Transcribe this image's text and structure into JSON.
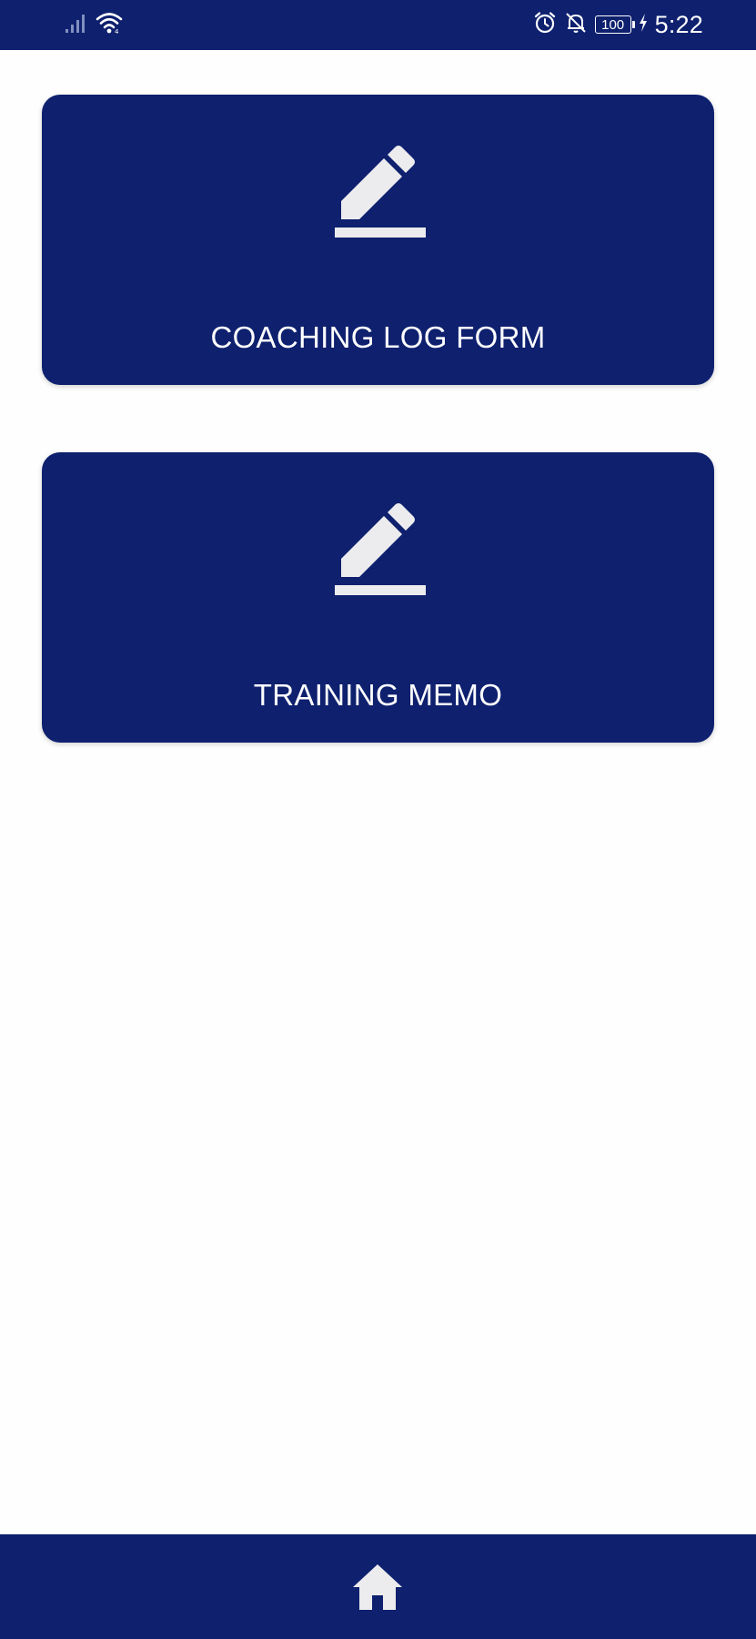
{
  "status_bar": {
    "time": "5:22",
    "battery_level": "100",
    "icons": [
      "signal-icon",
      "wifi-icon",
      "alarm-icon",
      "notifications-off-icon",
      "battery-icon",
      "charging-icon"
    ]
  },
  "cards": [
    {
      "label": "COACHING LOG FORM",
      "icon": "edit-icon"
    },
    {
      "label": "TRAINING MEMO",
      "icon": "edit-icon"
    }
  ],
  "bottom_nav": {
    "icon": "home-icon"
  },
  "colors": {
    "primary": "#0e206e",
    "icon_fill": "#ececee",
    "background": "#fefefe"
  }
}
